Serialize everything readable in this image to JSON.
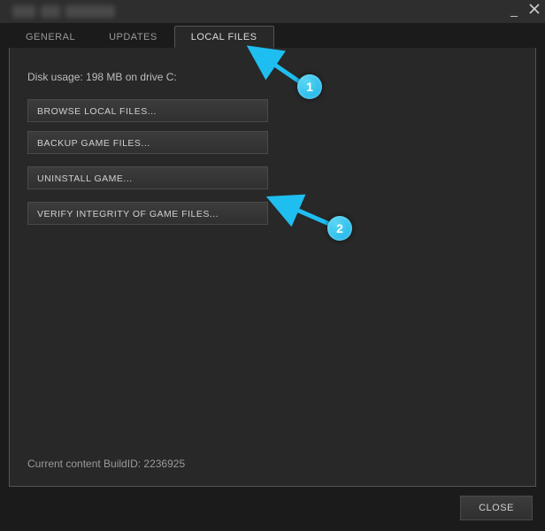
{
  "window": {
    "title_blurred": true
  },
  "tabs": {
    "general": "GENERAL",
    "updates": "UPDATES",
    "local_files": "LOCAL FILES"
  },
  "panel": {
    "disk_usage": "Disk usage: 198 MB on drive C:",
    "browse": "BROWSE LOCAL FILES...",
    "backup": "BACKUP GAME FILES...",
    "uninstall": "UNINSTALL GAME...",
    "verify": "VERIFY INTEGRITY OF GAME FILES...",
    "buildid": "Current content BuildID: 2236925"
  },
  "footer": {
    "close": "CLOSE"
  },
  "annotations": {
    "one": "1",
    "two": "2"
  },
  "colors": {
    "accent": "#1fbef0"
  }
}
